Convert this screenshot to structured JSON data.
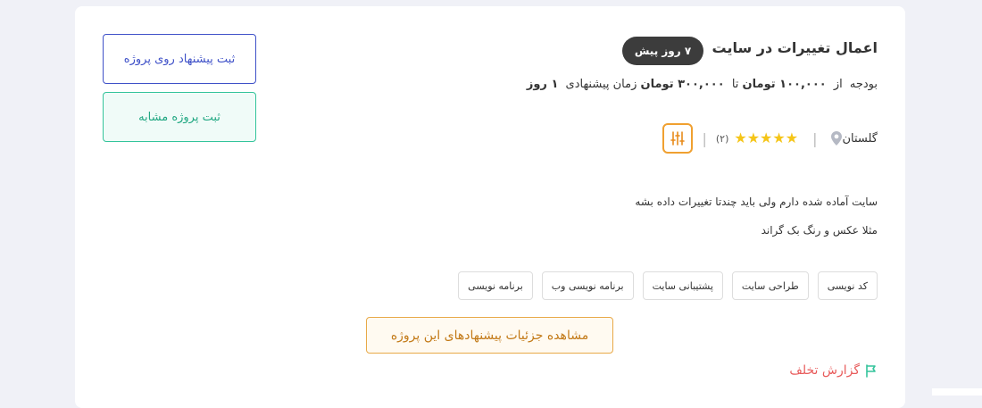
{
  "project": {
    "title": "اعمال تغییرات در سایت",
    "time_badge": "۷ روز پیش",
    "budget": {
      "label": "بودجه",
      "from_word": "از",
      "min": "۱۰۰,۰۰۰ تومان",
      "to_word": "تا",
      "max": "۳۰۰,۰۰۰ تومان",
      "time_label": "زمان پیشنهادی",
      "time_value": "۱ روز"
    },
    "rating": {
      "count": "(۲)",
      "stars": 5
    },
    "location": "گلستان",
    "description": [
      "سایت آماده شده دارم ولی باید چندتا تغییرات داده بشه",
      "مثلا عکس و رنگ بک گراند"
    ],
    "tags": [
      "برنامه نویسی",
      "برنامه نویسی وب",
      "پشتیبانی سایت",
      "طراحی سایت",
      "کد نویسی"
    ],
    "details_button": "مشاهده جزئیات پیشنهادهای این پروژه",
    "report": "گزارش تخلف"
  },
  "actions": {
    "offer_button": "ثبت پیشنهاد روی پروژه",
    "similar_button": "ثبت پروژه مشابه"
  },
  "colors": {
    "accent_blue": "#3f51c8",
    "accent_green": "#33c49b",
    "accent_orange": "#e8a948",
    "report_red": "#e85b5b",
    "star": "#f5c518"
  },
  "icons": {
    "filter": "sliders-icon",
    "star": "star-icon",
    "location": "map-pin-icon",
    "report": "flag-icon"
  }
}
